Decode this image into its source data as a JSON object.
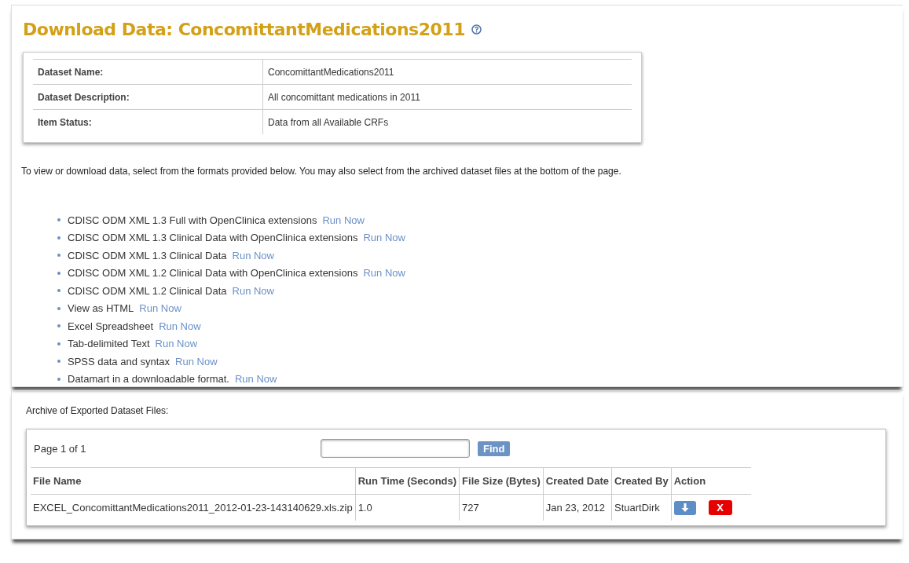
{
  "title": "Download Data: ConcomittantMedications2011",
  "info": [
    {
      "label": "Dataset Name:",
      "value": "ConcomittantMedications2011"
    },
    {
      "label": "Dataset Description:",
      "value": "All concomittant medications in 2011"
    },
    {
      "label": "Item Status:",
      "value": "Data from all Available CRFs"
    }
  ],
  "intro": "To view or download data, select from the formats provided below. You may also select from the archived dataset files at the bottom of the page.",
  "formats": [
    {
      "name": "CDISC ODM XML 1.3 Full with OpenClinica extensions",
      "link": "Run Now"
    },
    {
      "name": "CDISC ODM XML 1.3 Clinical Data with OpenClinica extensions",
      "link": "Run Now"
    },
    {
      "name": "CDISC ODM XML 1.3 Clinical Data",
      "link": "Run Now"
    },
    {
      "name": "CDISC ODM XML 1.2 Clinical Data with OpenClinica extensions",
      "link": "Run Now"
    },
    {
      "name": "CDISC ODM XML 1.2 Clinical Data",
      "link": "Run Now"
    },
    {
      "name": "View as HTML",
      "link": "Run Now"
    },
    {
      "name": "Excel Spreadsheet",
      "link": "Run Now"
    },
    {
      "name": "Tab-delimited Text",
      "link": "Run Now"
    },
    {
      "name": "SPSS data and syntax",
      "link": "Run Now"
    },
    {
      "name": "Datamart in a downloadable format.",
      "link": "Run Now"
    }
  ],
  "archive": {
    "heading": "Archive of Exported Dataset Files:",
    "page": "Page 1 of 1",
    "find_button": "Find",
    "columns": [
      "File Name",
      "Run Time (Seconds)",
      "File Size (Bytes)",
      "Created Date",
      "Created By",
      "Action"
    ],
    "rows": [
      {
        "cells": [
          "EXCEL_ConcomittantMedications2011_2012-01-23-143140629.xls.zip",
          "1.0",
          "727",
          "Jan 23, 2012",
          "StuartDirk"
        ],
        "delete": "X"
      }
    ]
  }
}
